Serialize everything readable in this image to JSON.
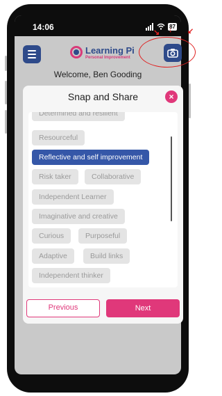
{
  "status_bar": {
    "time": "14:06",
    "battery": "87"
  },
  "app": {
    "logo_name": "Learning Pi",
    "logo_tagline": "Personal Improvement"
  },
  "welcome_text": "Welcome, Ben Gooding",
  "modal": {
    "title": "Snap and Share",
    "close_icon": "×",
    "chips": [
      {
        "label": "Determined and resilient",
        "selected": false
      },
      {
        "label": "Resourceful",
        "selected": false
      },
      {
        "label": "Reflective and self improvement",
        "selected": true
      },
      {
        "label": "Risk taker",
        "selected": false
      },
      {
        "label": "Collaborative",
        "selected": false
      },
      {
        "label": "Independent Learner",
        "selected": false
      },
      {
        "label": "Imaginative and creative",
        "selected": false
      },
      {
        "label": "Curious",
        "selected": false
      },
      {
        "label": "Purposeful",
        "selected": false
      },
      {
        "label": "Adaptive",
        "selected": false
      },
      {
        "label": "Build links",
        "selected": false
      },
      {
        "label": "Independent thinker",
        "selected": false
      }
    ],
    "previous_label": "Previous",
    "next_label": "Next"
  },
  "colors": {
    "primary": "#2e4a8a",
    "accent": "#e0387a",
    "selected_chip": "#3557a8",
    "annotation": "#e02020"
  },
  "icons": {
    "menu": "hamburger-menu-icon",
    "camera": "camera-icon",
    "close": "close-icon"
  }
}
